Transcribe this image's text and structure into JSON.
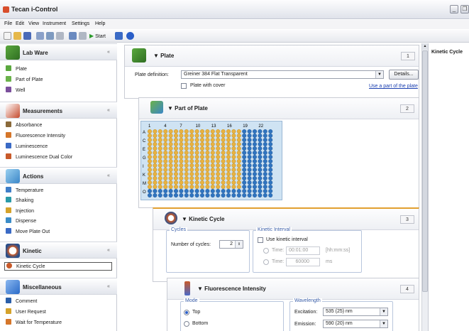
{
  "window": {
    "title": "Tecan i-Control",
    "minimize": "_",
    "restore": "❐"
  },
  "menu": [
    "File",
    "Edit",
    "View",
    "Instrument",
    "Settings",
    "Help"
  ],
  "toolbar": {
    "start_label": "Start"
  },
  "left": {
    "sections": [
      {
        "key": "labware",
        "title": "Lab Ware",
        "color": "#4f9a3a",
        "items": [
          {
            "label": "Plate",
            "color": "#5aa83e"
          },
          {
            "label": "Part of Plate",
            "color": "#6ab24a"
          },
          {
            "label": "Well",
            "color": "#7b4f9c"
          }
        ]
      },
      {
        "key": "measurements",
        "title": "Measurements",
        "color": "#c5492b",
        "items": [
          {
            "label": "Absorbance",
            "color": "#8a6a3a"
          },
          {
            "label": "Fluorescence Intensity",
            "color": "#d5762a"
          },
          {
            "label": "Luminescence",
            "color": "#3a6ac5"
          },
          {
            "label": "Luminescence Dual Color",
            "color": "#c85a2a"
          }
        ]
      },
      {
        "key": "actions",
        "title": "Actions",
        "color": "#3a86c8",
        "items": [
          {
            "label": "Temperature",
            "color": "#3f7ec8"
          },
          {
            "label": "Shaking",
            "color": "#2a9aa8"
          },
          {
            "label": "Injection",
            "color": "#d5a22a"
          },
          {
            "label": "Dispense",
            "color": "#3a8cc8"
          },
          {
            "label": "Move Plate Out",
            "color": "#3a6ac5"
          }
        ]
      },
      {
        "key": "kinetic",
        "title": "Kinetic",
        "color": "#2a4f8a",
        "items": [
          {
            "label": "Kinetic Cycle",
            "color": "#c85a2a"
          }
        ]
      },
      {
        "key": "misc",
        "title": "Miscellaneous",
        "color": "#2a6ac8",
        "items": [
          {
            "label": "Comment",
            "color": "#2a5ea8"
          },
          {
            "label": "User Request",
            "color": "#d5a22a"
          },
          {
            "label": "Wait for Temperature",
            "color": "#d5762a"
          }
        ]
      }
    ],
    "chevron": "«"
  },
  "plate_card": {
    "title": "Plate",
    "num": "1",
    "def_label": "Plate definition:",
    "def_value": "Greiner 384 Flat Transparent",
    "details": "Details...",
    "cover_label": "Plate with cover",
    "link": "Use a part of the plate"
  },
  "part_card": {
    "title": "Part of Plate",
    "num": "2",
    "cols": [
      "1",
      "4",
      "7",
      "10",
      "13",
      "16",
      "19",
      "22"
    ],
    "rows": [
      "A",
      "C",
      "E",
      "G",
      "I",
      "K",
      "M",
      "O"
    ]
  },
  "kinetic_card": {
    "title": "Kinetic Cycle",
    "num": "3",
    "cycles_group": "Cycles",
    "num_cycles_label": "Number of cycles:",
    "num_cycles_value": "2",
    "interval_group": "Kinetic Interval",
    "use_interval": "Use kinetic interval",
    "time_label1": "Time:",
    "time_value1": "00:01:00",
    "time_unit1": "[hh:mm:ss]",
    "time_label2": "Time:",
    "time_value2": "60000",
    "time_unit2": "ms"
  },
  "fluor_card": {
    "title": "Fluorescence Intensity",
    "num": "4",
    "mode_group": "Mode",
    "top": "Top",
    "bottom": "Bottom",
    "wave_group": "Wavelength",
    "ex_label": "Excitation:",
    "ex_value": "535 (25) nm",
    "em_label": "Emission:",
    "em_value": "590 (20) nm"
  },
  "right": {
    "title": "Kinetic Cycle"
  }
}
